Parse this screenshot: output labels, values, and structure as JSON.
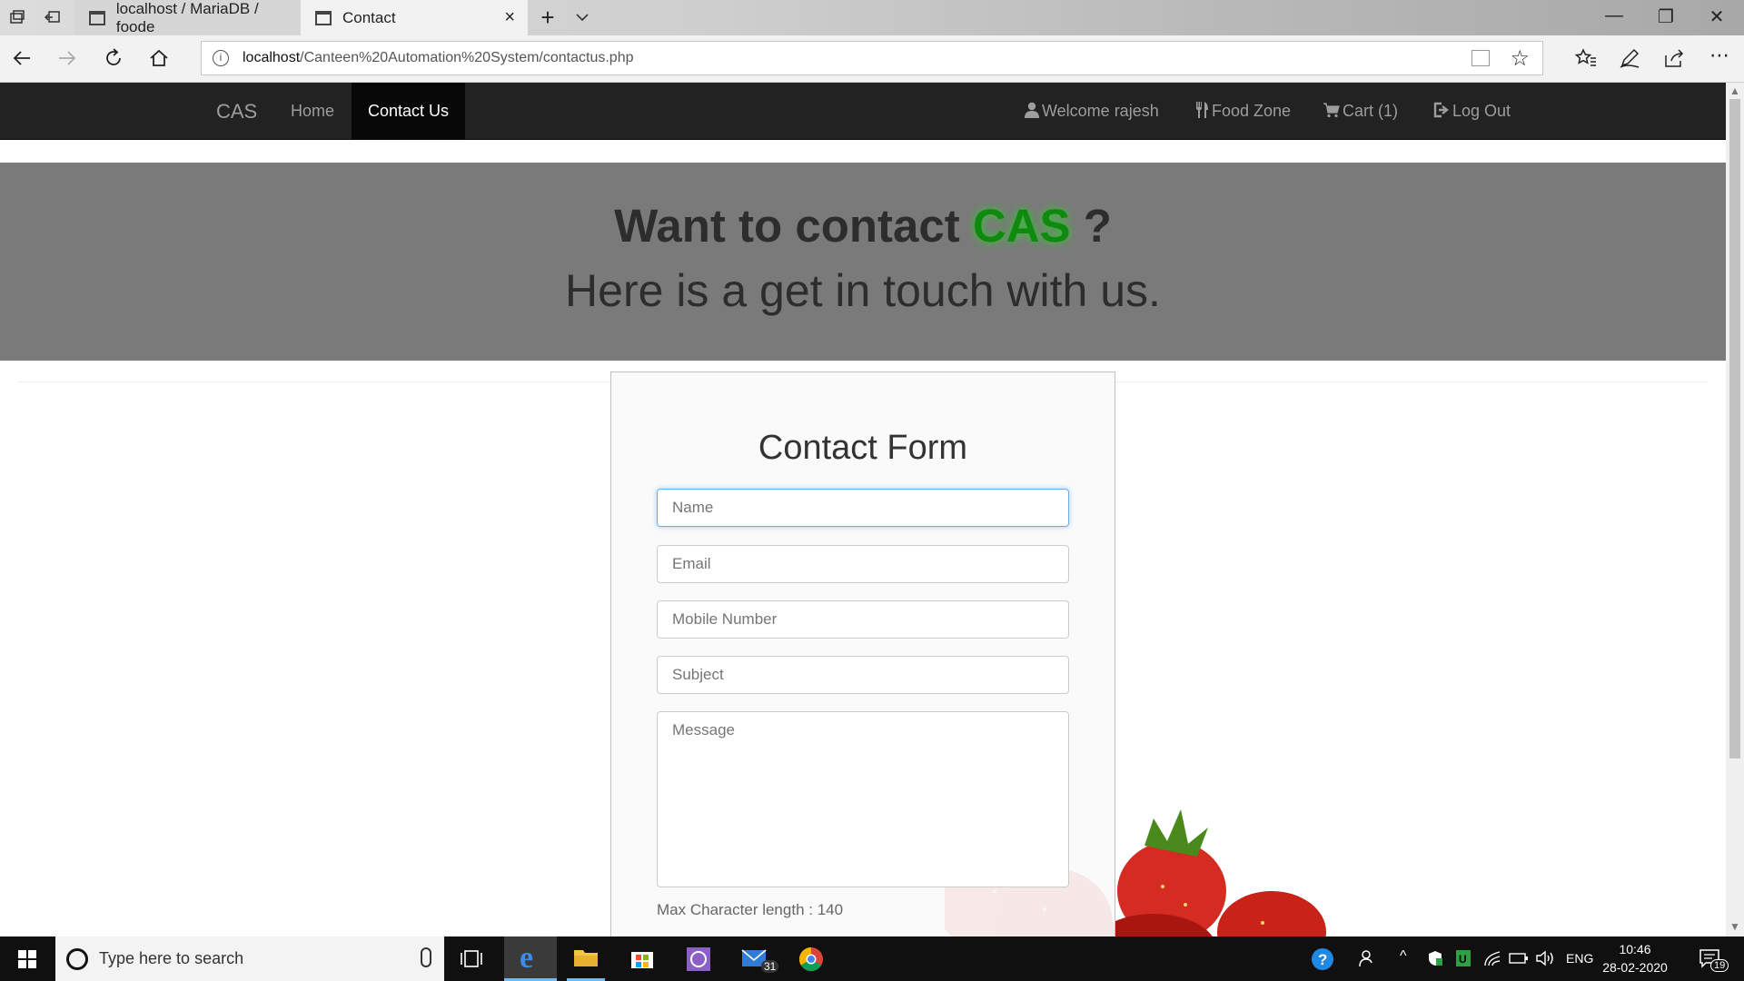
{
  "browser": {
    "tabs": [
      {
        "label": "localhost / MariaDB / foode"
      },
      {
        "label": "Contact"
      }
    ],
    "new_tab": "+",
    "close_tab": "×",
    "url_host": "localhost",
    "url_path": "/Canteen%20Automation%20System/contactus.php",
    "window_buttons": {
      "minimize": "—",
      "restore": "❐",
      "close": "✕"
    }
  },
  "navbar": {
    "brand": "CAS",
    "left_items": [
      {
        "label": "Home"
      },
      {
        "label": "Contact Us",
        "active": true
      }
    ],
    "right_items": [
      {
        "label": "Welcome rajesh",
        "icon": "user-icon"
      },
      {
        "label": "Food Zone",
        "icon": "cutlery-icon"
      },
      {
        "label": "Cart (1)",
        "icon": "cart-icon"
      },
      {
        "label": "Log Out",
        "icon": "logout-icon"
      }
    ]
  },
  "hero": {
    "line1_prefix": "Want to contact",
    "line1_brand": "CAS",
    "line1_suffix": "?",
    "line2": "Here is a get in touch with us."
  },
  "form": {
    "title": "Contact Form",
    "name_placeholder": "Name",
    "email_placeholder": "Email",
    "mobile_placeholder": "Mobile Number",
    "subject_placeholder": "Subject",
    "message_placeholder": "Message",
    "max_length_note": "Max Character length : 140"
  },
  "taskbar": {
    "search_placeholder": "Type here to search",
    "mail_badge": "31",
    "language": "ENG",
    "time": "10:46",
    "date": "28-02-2020",
    "notifications": "19"
  },
  "colors": {
    "navbar_bg": "#222222",
    "hero_bg": "#7a7a7a",
    "brand_green": "#0f8a0f",
    "focus_blue": "#66afe9"
  }
}
